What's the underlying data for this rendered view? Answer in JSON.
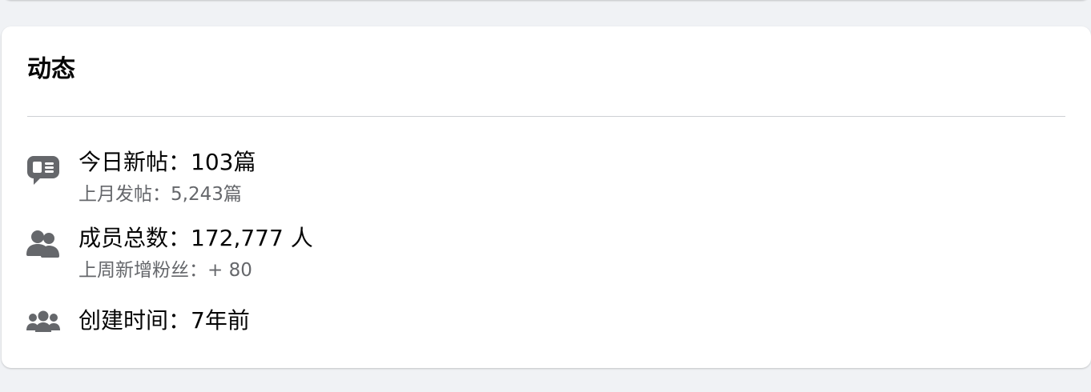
{
  "activity": {
    "title": "动态",
    "items": [
      {
        "icon": "chat-bubble-icon",
        "primary": "今日新帖：103篇",
        "secondary": "上月发帖：5,243篇"
      },
      {
        "icon": "members-icon",
        "primary": "成员总数：172,777 人",
        "secondary": "上周新增粉丝：+ 80"
      },
      {
        "icon": "group-icon",
        "primary": "创建时间：7年前"
      }
    ]
  },
  "colors": {
    "page_background": "#f0f2f5",
    "card_background": "#ffffff",
    "primary_text": "#050505",
    "secondary_text": "#65676b",
    "icon_color": "#65676b",
    "divider": "#ced0d4"
  }
}
